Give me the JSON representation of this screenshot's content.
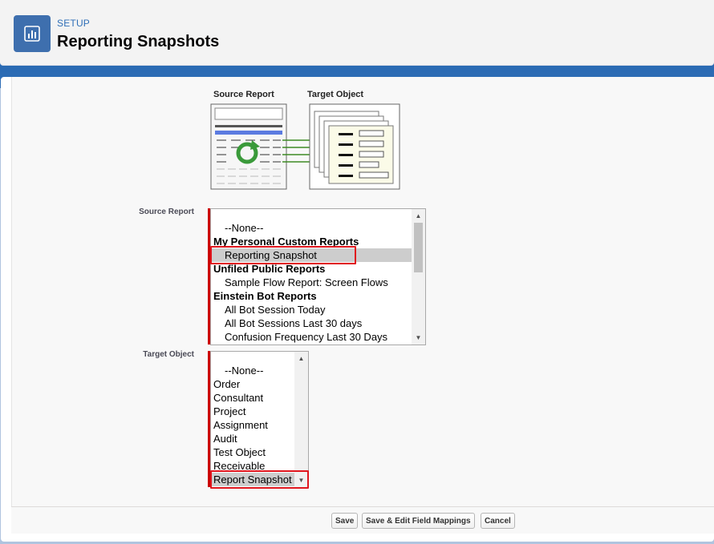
{
  "header": {
    "section_label": "SETUP",
    "title": "Reporting Snapshots",
    "icon": "bar-chart-icon"
  },
  "diagram": {
    "source_label": "Source Report",
    "target_label": "Target Object"
  },
  "source_report": {
    "label": "Source Report",
    "options": [
      {
        "text": "--None--",
        "kind": "option"
      },
      {
        "text": "My Personal Custom Reports",
        "kind": "group"
      },
      {
        "text": "Reporting Snapshot",
        "kind": "option",
        "selected": true
      },
      {
        "text": "Unfiled Public Reports",
        "kind": "group"
      },
      {
        "text": "Sample Flow Report: Screen Flows",
        "kind": "option"
      },
      {
        "text": "Einstein Bot Reports",
        "kind": "group"
      },
      {
        "text": "All Bot Session Today",
        "kind": "option"
      },
      {
        "text": "All Bot Sessions Last 30 days",
        "kind": "option"
      },
      {
        "text": "Confusion Frequency Last 30 Days",
        "kind": "option"
      }
    ]
  },
  "target_object": {
    "label": "Target Object",
    "options": [
      {
        "text": "--None--",
        "kind": "option"
      },
      {
        "text": "Order",
        "kind": "plain"
      },
      {
        "text": "Consultant",
        "kind": "plain"
      },
      {
        "text": "Project",
        "kind": "plain"
      },
      {
        "text": "Assignment",
        "kind": "plain"
      },
      {
        "text": "Audit",
        "kind": "plain"
      },
      {
        "text": "Test Object",
        "kind": "plain"
      },
      {
        "text": "Receivable",
        "kind": "plain"
      },
      {
        "text": "Report Snapshot",
        "kind": "plain",
        "selected": true
      }
    ]
  },
  "buttons": {
    "save": "Save",
    "save_edit": "Save & Edit Field Mappings",
    "cancel": "Cancel"
  },
  "colors": {
    "accent": "#3e6fae",
    "highlight": "#e0161e",
    "required": "#cc0000"
  }
}
